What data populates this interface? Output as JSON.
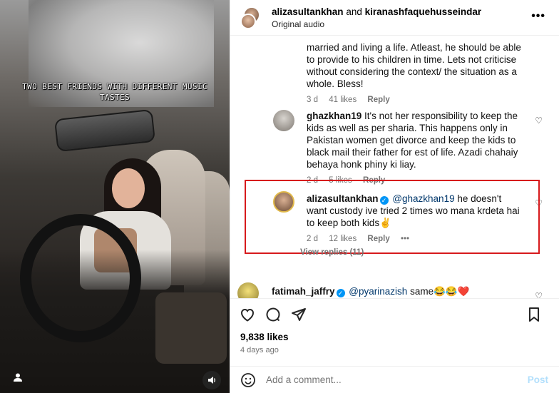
{
  "video": {
    "caption": "TWO BEST FRIENDS WITH DIFFERENT MUSIC\nTASTES",
    "user_tag_icon": "user-tag-icon",
    "mute_icon": "speaker-icon"
  },
  "header": {
    "user1": "alizasultankhan",
    "joiner": "and",
    "user2": "kiranashfaquehusseindar",
    "audio": "Original audio",
    "more_icon": "more-options-icon"
  },
  "comments": [
    {
      "text": "married and living a life. Atleast, he should be able to provide to his children in time. Lets not criticise without considering the context/ the situation as a whole. Bless!",
      "time": "3 d",
      "likes": "41 likes",
      "reply": "Reply"
    },
    {
      "user": "ghazkhan19",
      "text": "It's not her responsibility to keep the kids as well as per sharia. This happens only in Pakistan women get divorce and keep the kids to black mail their father for est of life. Azadi chahaiy behaya honk phiny ki liay.",
      "time": "2 d",
      "likes": "5 likes",
      "reply": "Reply"
    },
    {
      "user": "alizasultankhan",
      "mention": "@ghazkhan19",
      "text": "he doesn't want custody ive tried 2 times wo mana krdeta hai to keep both kids✌",
      "time": "2 d",
      "likes": "12 likes",
      "reply": "Reply",
      "more": "•••"
    },
    {
      "user": "fatimah_jaffry",
      "mention": "@pyarinazish",
      "text": "same😂😂❤️"
    }
  ],
  "view_replies": "View replies (11)",
  "likes_count": "9,838 likes",
  "posted_ago": "4 days ago",
  "add_comment": {
    "placeholder": "Add a comment...",
    "post_label": "Post"
  },
  "colors": {
    "highlight_border": "#d7191c",
    "verified": "#0095f6",
    "post_disabled": "#b2dffc"
  }
}
